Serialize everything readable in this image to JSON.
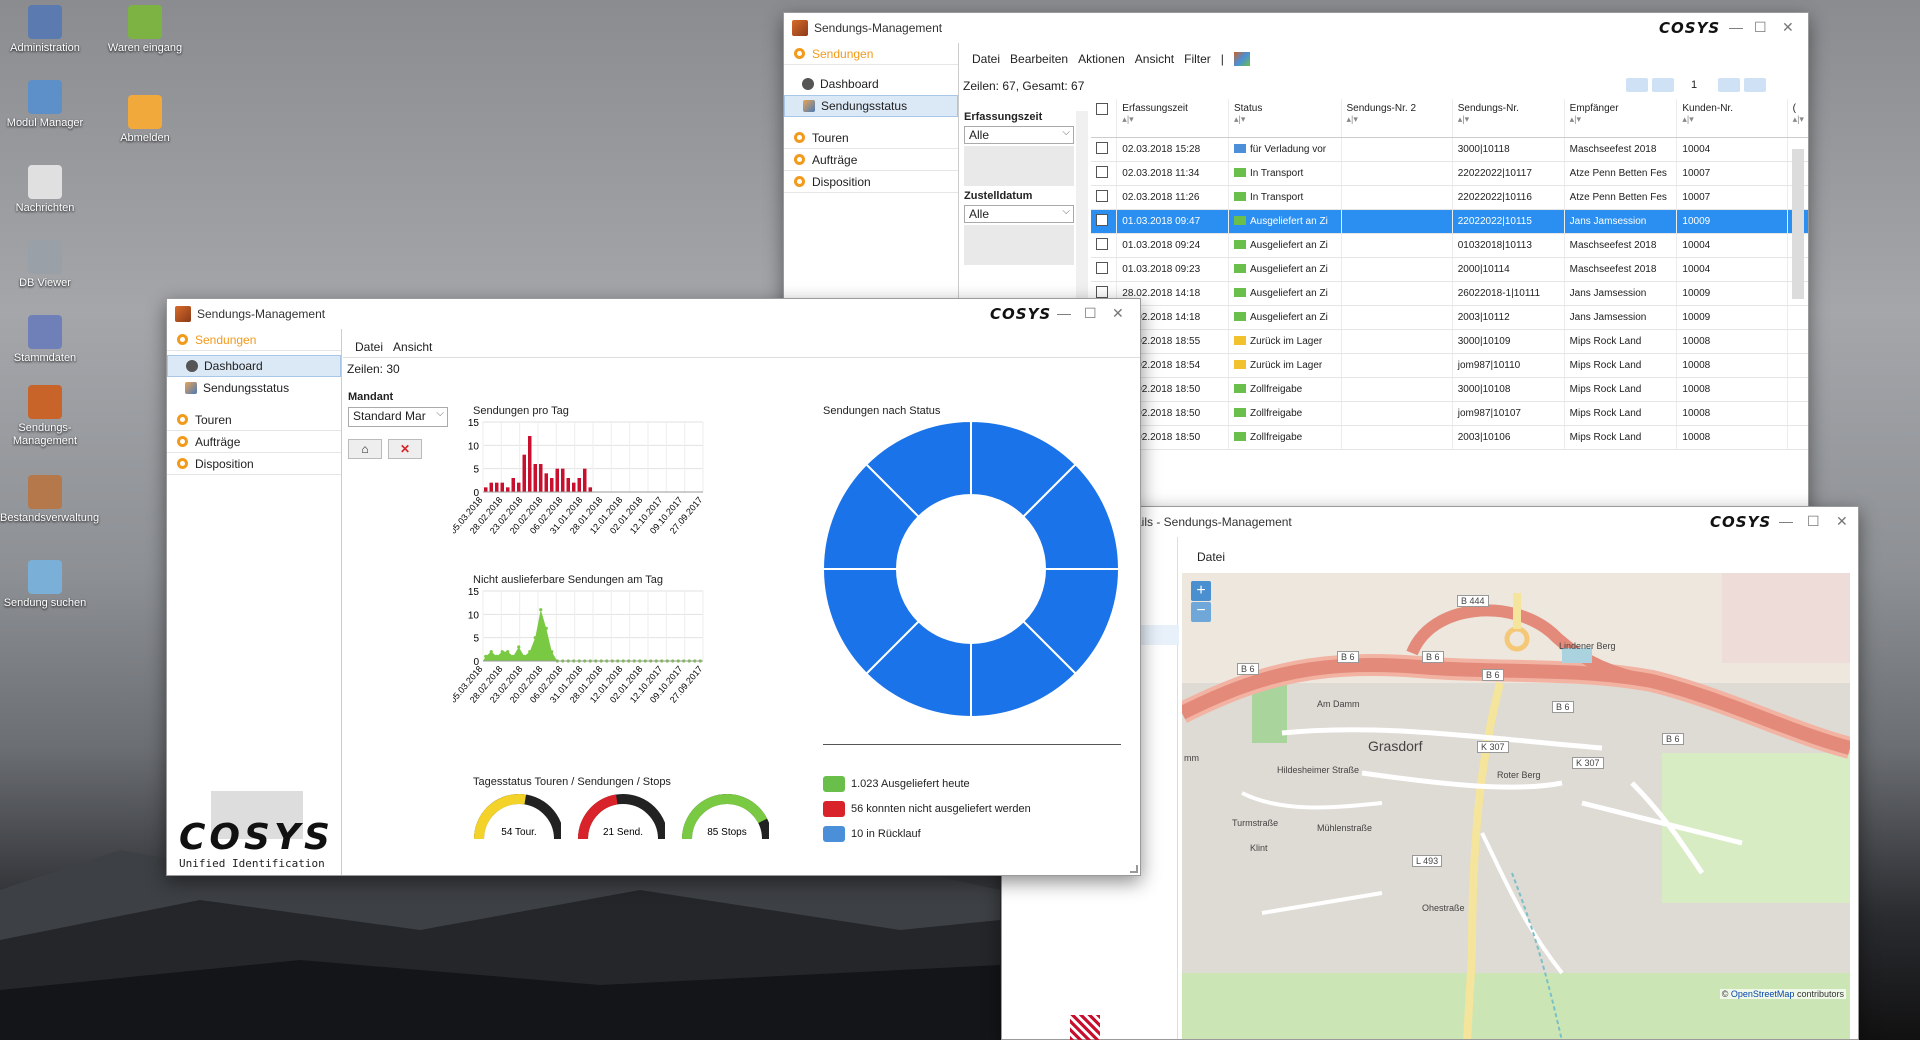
{
  "desktop_icons": [
    {
      "label": "Administration",
      "color": "#5a7ab0"
    },
    {
      "label": "Waren eingang",
      "color": "#7cb342"
    },
    {
      "label": "Modul Manager",
      "color": "#5d8fc8"
    },
    {
      "label": "Abmelden",
      "color": "#f2a93b"
    },
    {
      "label": "Nachrichten",
      "color": "#e0e0e0"
    },
    {
      "label": "DB Viewer",
      "color": "#9aa0a8"
    },
    {
      "label": "Stammdaten",
      "color": "#6f7fb8"
    },
    {
      "label": "Sendungs-Management",
      "color": "#c8632a"
    },
    {
      "label": "Bestandsverwaltung",
      "color": "#b5784a"
    },
    {
      "label": "Sendung suchen",
      "color": "#7ab0d8"
    }
  ],
  "brand": "COSYS",
  "list_window": {
    "title": "Sendungs-Management",
    "menu": [
      "Datei",
      "Bearbeiten",
      "Aktionen",
      "Ansicht",
      "Filter",
      "|"
    ],
    "sidebar": {
      "groups": [
        {
          "label": "Sendungen",
          "active": true,
          "items": [
            "Dashboard",
            "Sendungsstatus"
          ]
        },
        {
          "label": "Touren"
        },
        {
          "label": "Aufträge"
        },
        {
          "label": "Disposition"
        }
      ]
    },
    "rows_info": "Zeilen: 67, Gesamt: 67",
    "page": "1",
    "filters": [
      {
        "label": "Erfassungszeit",
        "value": "Alle"
      },
      {
        "label": "Zustelldatum",
        "value": "Alle"
      }
    ],
    "columns": [
      "Erfassungszeit",
      "Status",
      "Sendungs-Nr. 2",
      "Sendungs-Nr.",
      "Empfänger",
      "Kunden-Nr.",
      "("
    ],
    "rows": [
      {
        "time": "02.03.2018 15:28",
        "status": "für Verladung vor",
        "icon": "#4a8fd8",
        "nr2": "",
        "nr": "3000|10118",
        "recv": "Maschseefest 2018",
        "kd": "10004"
      },
      {
        "time": "02.03.2018 11:34",
        "status": "In Transport",
        "icon": "#6abf4b",
        "nr2": "",
        "nr": "22022022|10117",
        "recv": "Atze Penn Betten Fes",
        "kd": "10007"
      },
      {
        "time": "02.03.2018 11:26",
        "status": "In Transport",
        "icon": "#6abf4b",
        "nr2": "",
        "nr": "22022022|10116",
        "recv": "Atze Penn Betten Fes",
        "kd": "10007"
      },
      {
        "time": "01.03.2018 09:47",
        "status": "Ausgeliefert an Zi",
        "icon": "#6abf4b",
        "nr2": "",
        "nr": "22022022|10115",
        "recv": "Jans Jamsession",
        "kd": "10009",
        "sel": true
      },
      {
        "time": "01.03.2018 09:24",
        "status": "Ausgeliefert an Zi",
        "icon": "#6abf4b",
        "nr2": "",
        "nr": "01032018|10113",
        "recv": "Maschseefest 2018",
        "kd": "10004"
      },
      {
        "time": "01.03.2018 09:23",
        "status": "Ausgeliefert an Zi",
        "icon": "#6abf4b",
        "nr2": "",
        "nr": "2000|10114",
        "recv": "Maschseefest 2018",
        "kd": "10004"
      },
      {
        "time": "28.02.2018 14:18",
        "status": "Ausgeliefert an Zi",
        "icon": "#6abf4b",
        "nr2": "",
        "nr": "26022018-1|10111",
        "recv": "Jans Jamsession",
        "kd": "10009"
      },
      {
        "time": "28.02.2018 14:18",
        "status": "Ausgeliefert an Zi",
        "icon": "#6abf4b",
        "nr2": "",
        "nr": "2003|10112",
        "recv": "Jans Jamsession",
        "kd": "10009"
      },
      {
        "time": "28.02.2018 18:55",
        "status": "Zurück im Lager",
        "icon": "#f2c12e",
        "nr2": "",
        "nr": "3000|10109",
        "recv": "Mips Rock Land",
        "kd": "10008"
      },
      {
        "time": "28.02.2018 18:54",
        "status": "Zurück im Lager",
        "icon": "#f2c12e",
        "nr2": "",
        "nr": "jom987|10110",
        "recv": "Mips Rock Land",
        "kd": "10008"
      },
      {
        "time": "28.02.2018 18:50",
        "status": "Zollfreigabe",
        "icon": "#6abf4b",
        "nr2": "",
        "nr": "3000|10108",
        "recv": "Mips Rock Land",
        "kd": "10008"
      },
      {
        "time": "28.02.2018 18:50",
        "status": "Zollfreigabe",
        "icon": "#6abf4b",
        "nr2": "",
        "nr": "jom987|10107",
        "recv": "Mips Rock Land",
        "kd": "10008"
      },
      {
        "time": "28.02.2018 18:50",
        "status": "Zollfreigabe",
        "icon": "#6abf4b",
        "nr2": "",
        "nr": "2003|10106",
        "recv": "Mips Rock Land",
        "kd": "10008"
      }
    ]
  },
  "dash_window": {
    "title": "Sendungs-Management",
    "menu": [
      "Datei",
      "Ansicht"
    ],
    "rows_info": "Zeilen: 30",
    "sidebar": {
      "groups": [
        {
          "label": "Sendungen",
          "active": true,
          "items": [
            "Dashboard",
            "Sendungsstatus"
          ]
        },
        {
          "label": "Touren"
        },
        {
          "label": "Aufträge"
        },
        {
          "label": "Disposition"
        }
      ]
    },
    "mandant_label": "Mandant",
    "mandant_value": "Standard Mar",
    "logo_sub": "Unified Identification",
    "chart1_title": "Sendungen pro Tag",
    "chart2_title": "Nicht auslieferbare Sendungen am Tag",
    "donut_title": "Sendungen nach Status",
    "gauges_title": "Tagesstatus Touren / Sendungen / Stops",
    "gauges": [
      {
        "label": "54 Tour.",
        "color": "#f3d22a",
        "fraction": 0.55
      },
      {
        "label": "21 Send.",
        "color": "#d8232a",
        "fraction": 0.45
      },
      {
        "label": "85 Stops",
        "color": "#7ac943",
        "fraction": 0.85
      }
    ],
    "legend": [
      {
        "text": "1.023 Ausgeliefert heute",
        "color": "#6abf4b"
      },
      {
        "text": "56 konnten nicht ausgeliefert werden",
        "color": "#d8232a"
      },
      {
        "text": "10 in Rücklauf",
        "color": "#4a8fd8"
      }
    ]
  },
  "chart_data": [
    {
      "type": "bar",
      "title": "Sendungen pro Tag",
      "ylim": [
        0,
        15
      ],
      "yticks": [
        0,
        5,
        10,
        15
      ],
      "xticks": [
        "05.03.2018",
        "28.02.2018",
        "23.02.2018",
        "20.02.2018",
        "06.02.2018",
        "31.01.2018",
        "28.01.2018",
        "12.01.2018",
        "02.01.2018",
        "12.10.2017",
        "09.10.2017",
        "27.09.2017"
      ],
      "series": [
        {
          "color": "#c8102e",
          "values": [
            1,
            2,
            2,
            2,
            1,
            3,
            2,
            8,
            12,
            6,
            6,
            4,
            3,
            5,
            5,
            3,
            2,
            3,
            5,
            1,
            0,
            0,
            0,
            0,
            0,
            0,
            0,
            0,
            0,
            0,
            0,
            0,
            0,
            0,
            0,
            0,
            0,
            0,
            0,
            0
          ]
        }
      ]
    },
    {
      "type": "area",
      "title": "Nicht auslieferbare Sendungen am Tag",
      "ylim": [
        0,
        15
      ],
      "yticks": [
        0,
        5,
        10,
        15
      ],
      "xticks": [
        "05.03.2018",
        "28.02.2018",
        "23.02.2018",
        "20.02.2018",
        "06.02.2018",
        "31.01.2018",
        "28.01.2018",
        "12.01.2018",
        "02.01.2018",
        "12.10.2017",
        "09.10.2017",
        "27.09.2017"
      ],
      "series": [
        {
          "color": "#7ac943",
          "values": [
            1,
            2,
            1,
            2,
            2,
            1,
            3,
            1,
            2,
            5,
            11,
            7,
            2,
            0,
            0,
            0,
            0,
            0,
            0,
            0,
            0,
            0,
            0,
            0,
            0,
            0,
            0,
            0,
            0,
            0,
            0,
            0,
            0,
            0,
            0,
            0,
            0,
            0,
            0,
            0
          ]
        }
      ]
    },
    {
      "type": "pie",
      "title": "Sendungen nach Status",
      "series": [
        {
          "color": "#1a73e8",
          "values": [
            1,
            1,
            1,
            1,
            1,
            1,
            1,
            1
          ]
        }
      ]
    }
  ],
  "map_window": {
    "title": "ails - Sendungs-Management",
    "menu": [
      "Datei"
    ],
    "attribution_link": "OpenStreetMap",
    "attribution": "contributors",
    "labels": [
      "B 444",
      "B 6",
      "B 6",
      "B 6",
      "B 6",
      "B 6",
      "B 6",
      "Lindener Berg",
      "Am Damm",
      "Grasdorf",
      "K 307",
      "K 307",
      "Hildesheimer Straße",
      "Roter Berg",
      "L 493",
      "Turmstraße",
      "Klint",
      "Mühlenstraße",
      "Ohestraße",
      "mm"
    ]
  }
}
